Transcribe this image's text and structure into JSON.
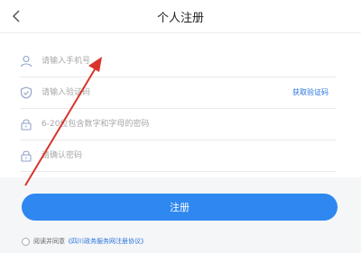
{
  "header": {
    "title": "个人注册",
    "back_icon": "chevron-left-icon"
  },
  "form": {
    "phone": {
      "placeholder": "请输入手机号",
      "value": "",
      "icon": "user-icon"
    },
    "code": {
      "placeholder": "请输入验证码",
      "value": "",
      "icon": "shield-check-icon",
      "button_label": "获取验证码"
    },
    "password": {
      "placeholder": "6-20位包含数字和字母的密码",
      "value": "",
      "icon": "lock-icon"
    },
    "confirm": {
      "placeholder": "请确认密码",
      "value": "",
      "icon": "lock-icon"
    }
  },
  "register_button": {
    "label": "注册"
  },
  "agreement": {
    "prefix": "阅读并同意",
    "link": "《四川政务服务网注册协议》",
    "checked": false
  },
  "colors": {
    "accent": "#2f87f0",
    "link": "#2a74dc",
    "annotation_arrow": "#d9342b"
  }
}
